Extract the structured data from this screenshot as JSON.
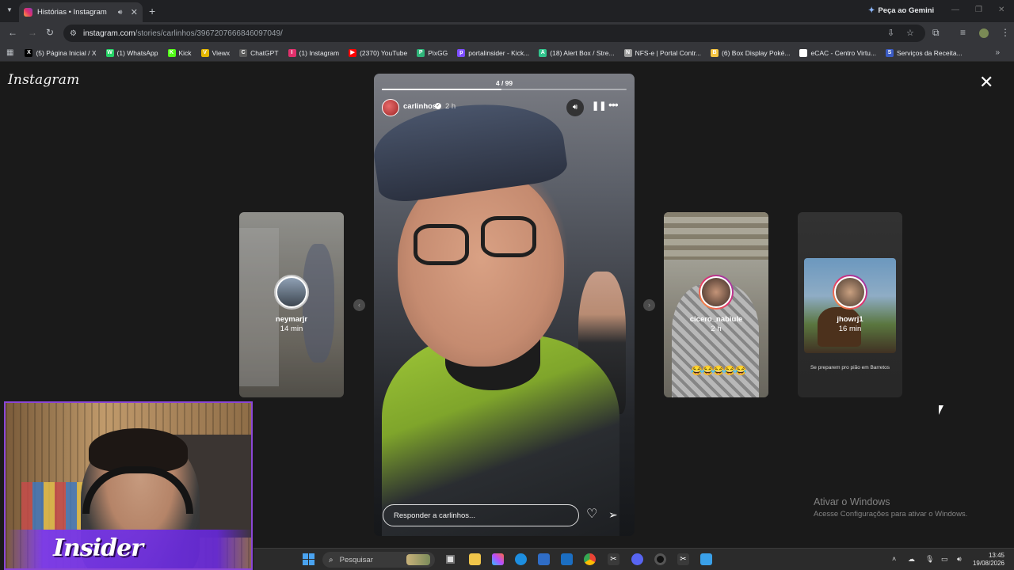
{
  "browser": {
    "tab_title": "Histórias • Instagram",
    "new_tab_label": "+",
    "gemini_label": "Peça ao Gemini",
    "url_host": "instagram.com",
    "url_path": "/stories/carlinhos/3967207666846097049/"
  },
  "bookmarks": [
    {
      "label": "(5) Página Inicial / X",
      "icon": "x-icon",
      "color": "#000000",
      "glyph": "X"
    },
    {
      "label": "(1) WhatsApp",
      "icon": "whatsapp-icon",
      "color": "#25d366",
      "glyph": "W"
    },
    {
      "label": "Kick",
      "icon": "kick-icon",
      "color": "#53fc18",
      "glyph": "K"
    },
    {
      "label": "Viewx",
      "icon": "viewx-icon",
      "color": "#e6b800",
      "glyph": "V"
    },
    {
      "label": "ChatGPT",
      "icon": "chatgpt-icon",
      "color": "#5a5a5a",
      "glyph": "C"
    },
    {
      "label": "(1) Instagram",
      "icon": "instagram-icon",
      "color": "#e1306c",
      "glyph": "I"
    },
    {
      "label": "(2370) YouTube",
      "icon": "youtube-icon",
      "color": "#ff0000",
      "glyph": "▶"
    },
    {
      "label": "PixGG",
      "icon": "pixgg-icon",
      "color": "#2fb67a",
      "glyph": "P"
    },
    {
      "label": "portalinsider - Kick...",
      "icon": "portalinsider-icon",
      "color": "#7c4dff",
      "glyph": "p"
    },
    {
      "label": "(18) Alert Box / Stre...",
      "icon": "alertbox-icon",
      "color": "#31c48d",
      "glyph": "A"
    },
    {
      "label": "NFS-e | Portal Contr...",
      "icon": "nfse-icon",
      "color": "#9e9e9e",
      "glyph": "N"
    },
    {
      "label": "(6) Box Display Poké...",
      "icon": "pokemon-icon",
      "color": "#f5c542",
      "glyph": "B"
    },
    {
      "label": "eCAC - Centro Virtu...",
      "icon": "ecac-icon",
      "color": "#ffffff",
      "glyph": "e"
    },
    {
      "label": "Serviços da Receita...",
      "icon": "receita-icon",
      "color": "#3b5cc4",
      "glyph": "S"
    }
  ],
  "page": {
    "logo": "Instagram",
    "close_label": "✕"
  },
  "story": {
    "progress_text": "4 / 99",
    "progress_fraction": 0.04,
    "username": "carlinhos",
    "time": "2 h",
    "reply_placeholder": "Responder a carlinhos..."
  },
  "side_stories": [
    {
      "name": "neymarjr",
      "time": "14 min"
    },
    {
      "name": "cicero_nabiule",
      "time": "2 h"
    },
    {
      "name": "jhowrj1",
      "time": "16 min",
      "caption": "Se preparem pro pião em Barretos"
    }
  ],
  "watermark": {
    "title": "Ativar o Windows",
    "subtitle": "Acesse Configurações para ativar o Windows."
  },
  "taskbar": {
    "search_placeholder": "Pesquisar",
    "time": "13:45",
    "date": "19/08/2026"
  },
  "webcam": {
    "overlay_text": "Insider"
  }
}
